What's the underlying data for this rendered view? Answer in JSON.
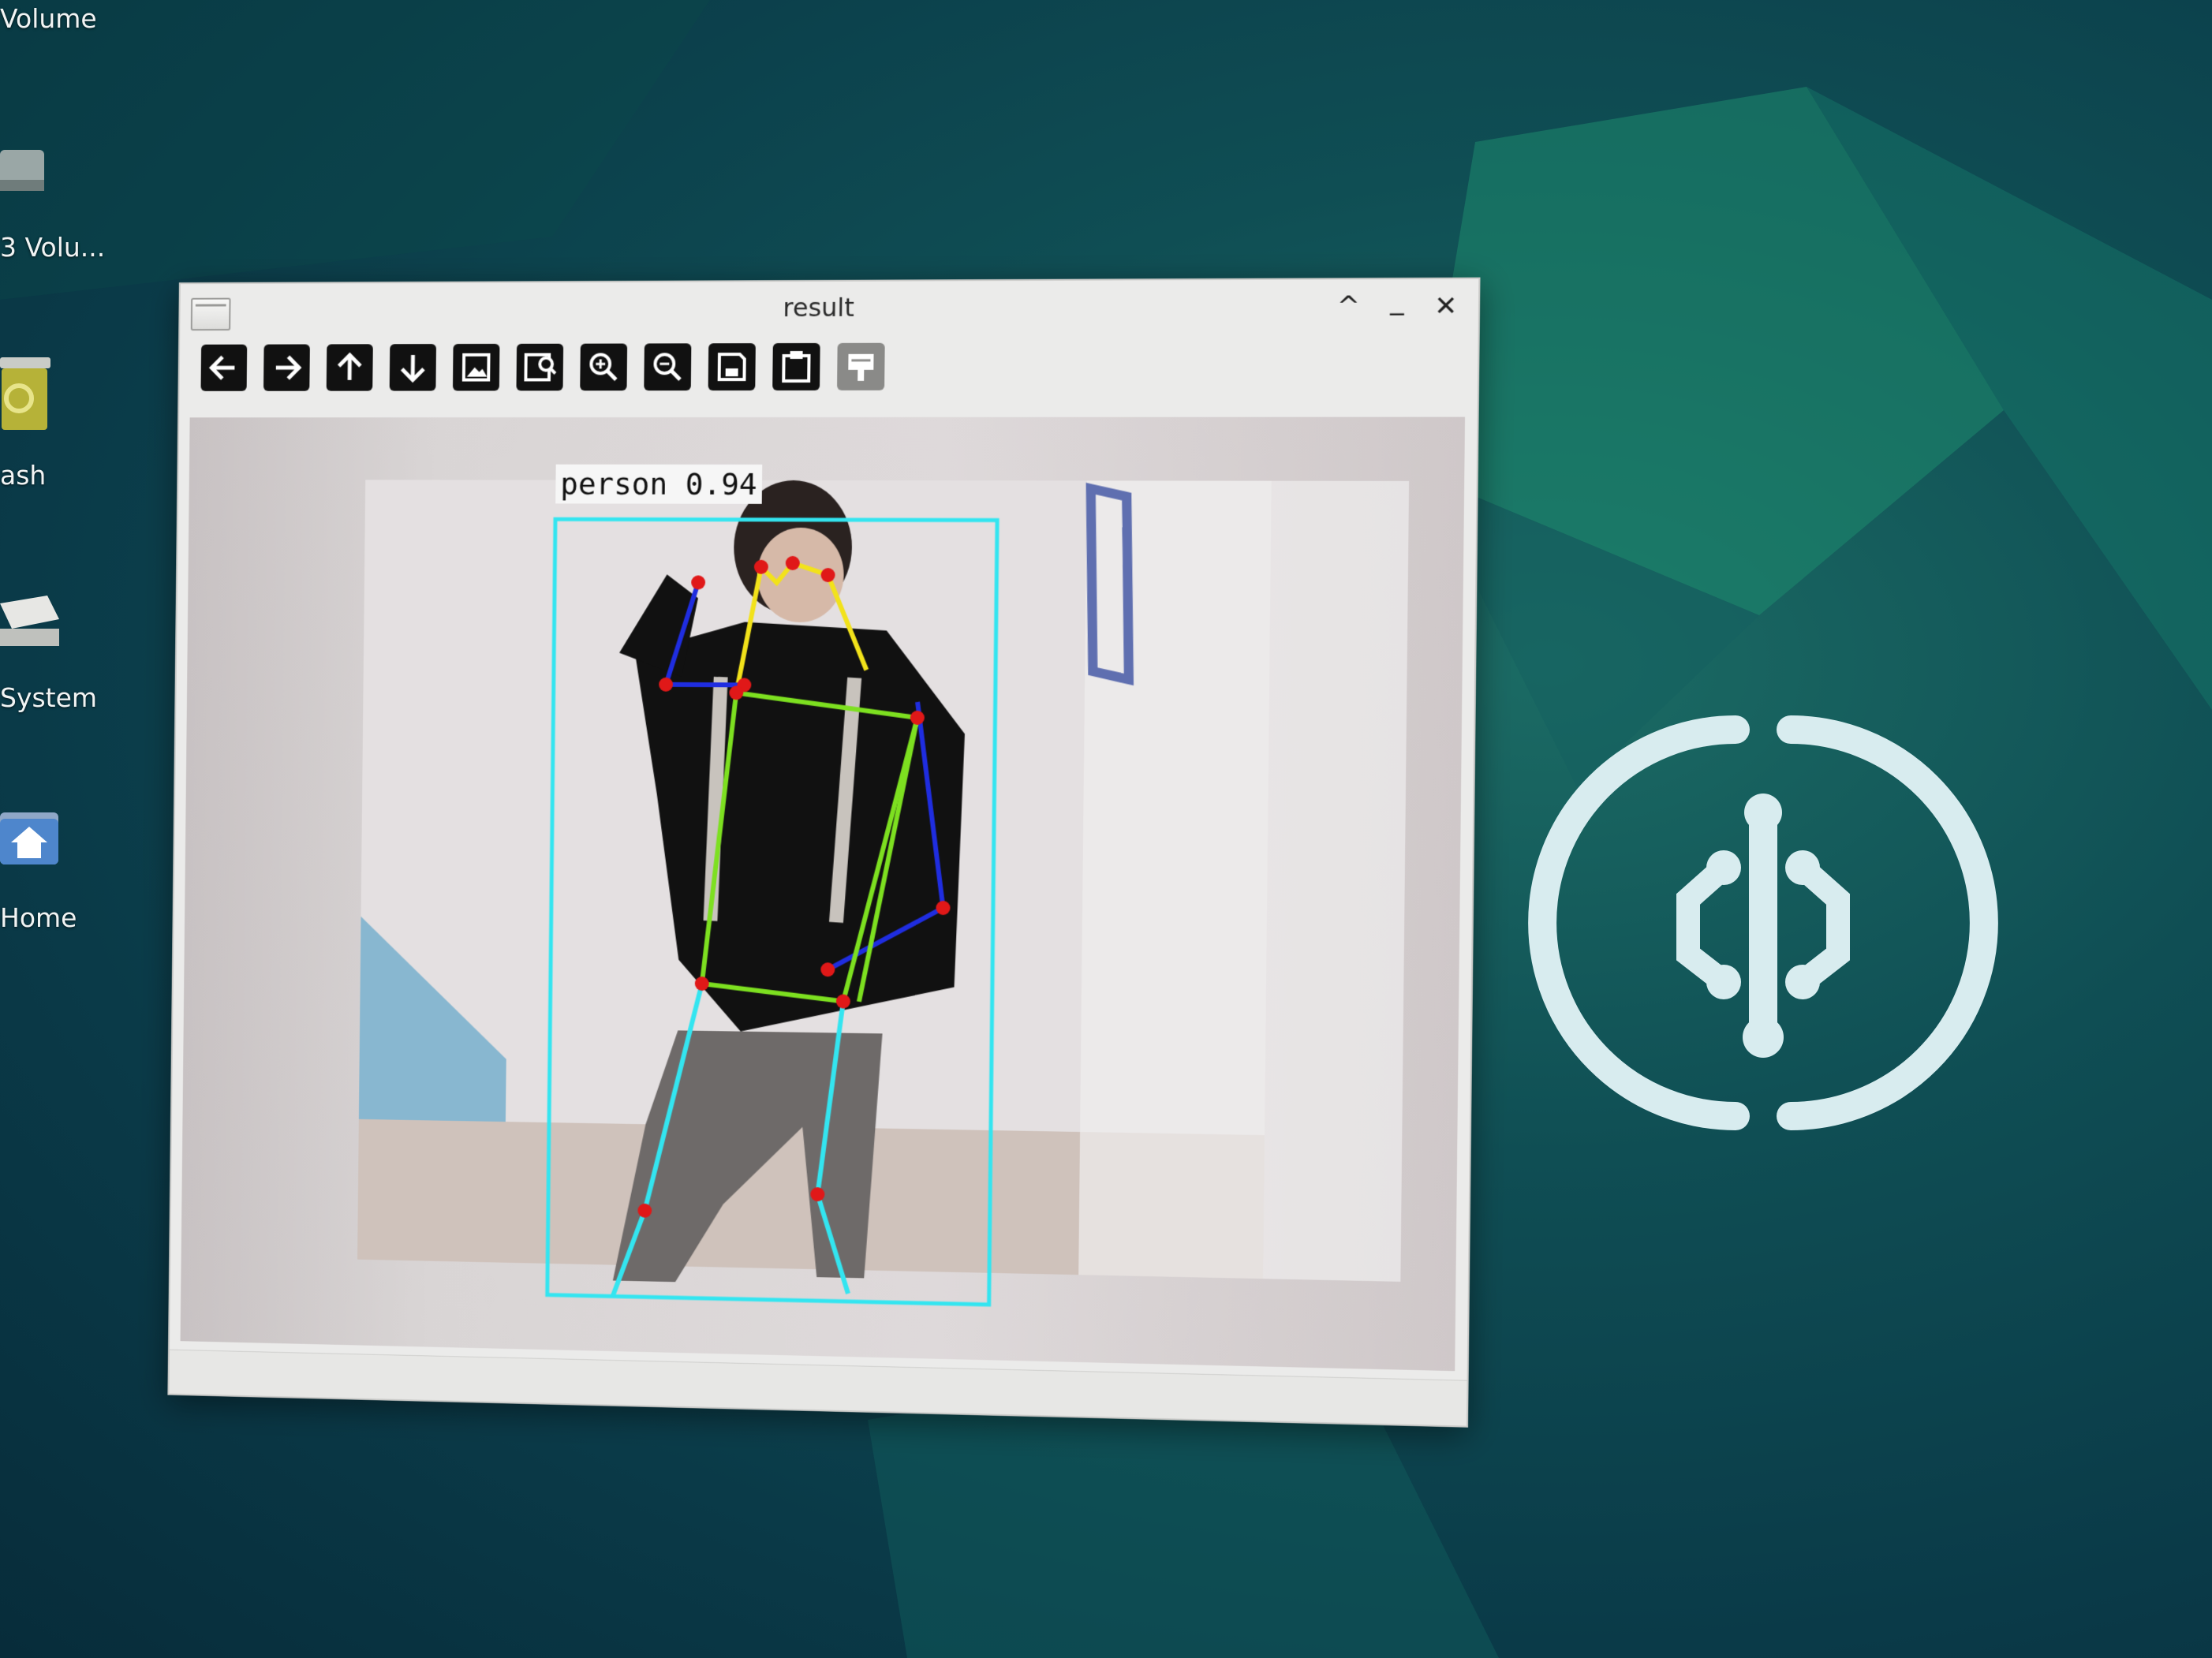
{
  "desktop": {
    "icons": [
      {
        "label": "Volume",
        "icon": "drive-icon"
      },
      {
        "label": "3 Volu...",
        "icon": "drive-icon"
      },
      {
        "label": "ash",
        "icon": "trash-icon"
      },
      {
        "label": "System",
        "icon": "drive-icon"
      },
      {
        "label": "Home",
        "icon": "home-folder-icon"
      }
    ]
  },
  "window": {
    "title": "result",
    "controls": [
      "maximize-icon",
      "minimize-icon",
      "close-icon"
    ],
    "control_glyphs": {
      "maximize": "^",
      "minimize": "_",
      "close": "✕"
    },
    "toolbar": [
      "arrow-left-icon",
      "arrow-right-icon",
      "arrow-up-icon",
      "arrow-down-icon",
      "image-icon",
      "image-zoom-icon",
      "zoom-in-icon",
      "zoom-out-icon",
      "save-icon",
      "clipboard-icon",
      "properties-icon"
    ]
  },
  "detection": {
    "label": "person 0.94",
    "colors": {
      "box": "#33e5f0",
      "keypoint": "#e01818",
      "head": "#f2e21a",
      "arms": "#1f2de0",
      "torso": "#7de020",
      "legs": "#33e5f0"
    }
  },
  "colors": {
    "desktop_bg": "#0f4e54",
    "logo": "#d8ecef"
  }
}
